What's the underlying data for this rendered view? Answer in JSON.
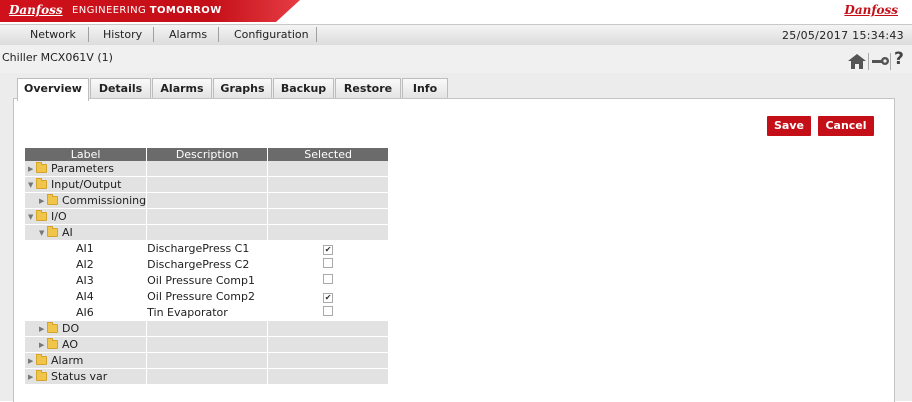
{
  "brand": {
    "logo": "Danfoss",
    "tagline_a": "ENGINEERING ",
    "tagline_b": "TOMORROW",
    "logo_right": "Danfoss"
  },
  "menu": {
    "items": [
      "Network",
      "History",
      "Alarms",
      "Configuration"
    ],
    "datetime": "25/05/2017 15:34:43"
  },
  "device": {
    "title": "Chiller MCX061V (1)"
  },
  "icons": {
    "home": "home-icon",
    "key": "key-icon",
    "help": "?"
  },
  "tabs": [
    "Overview",
    "Details",
    "Alarms",
    "Graphs",
    "Backup",
    "Restore",
    "Info"
  ],
  "active_tab": "Overview",
  "buttons": {
    "save": "Save",
    "cancel": "Cancel"
  },
  "colors": {
    "brand_red": "#c40f18",
    "header_gray": "#6b6b6b"
  },
  "table": {
    "headers": [
      "Label",
      "Description",
      "Selected"
    ],
    "rows": [
      {
        "label": "Parameters",
        "description": "",
        "selected": null
      },
      {
        "label": "Input/Output",
        "description": "",
        "selected": null
      },
      {
        "label": "Commissioning",
        "description": "",
        "selected": null
      },
      {
        "label": "I/O",
        "description": "",
        "selected": null
      },
      {
        "label": "AI",
        "description": "",
        "selected": null
      },
      {
        "label": "AI1",
        "description": "DischargePress C1",
        "selected": true
      },
      {
        "label": "AI2",
        "description": "DischargePress C2",
        "selected": false
      },
      {
        "label": "AI3",
        "description": "Oil Pressure Comp1",
        "selected": false
      },
      {
        "label": "AI4",
        "description": "Oil Pressure Comp2",
        "selected": true
      },
      {
        "label": "AI6",
        "description": "Tin Evaporator",
        "selected": false
      },
      {
        "label": "DO",
        "description": "",
        "selected": null
      },
      {
        "label": "AO",
        "description": "",
        "selected": null
      },
      {
        "label": "Alarm",
        "description": "",
        "selected": null
      },
      {
        "label": "Status var",
        "description": "",
        "selected": null
      }
    ]
  }
}
